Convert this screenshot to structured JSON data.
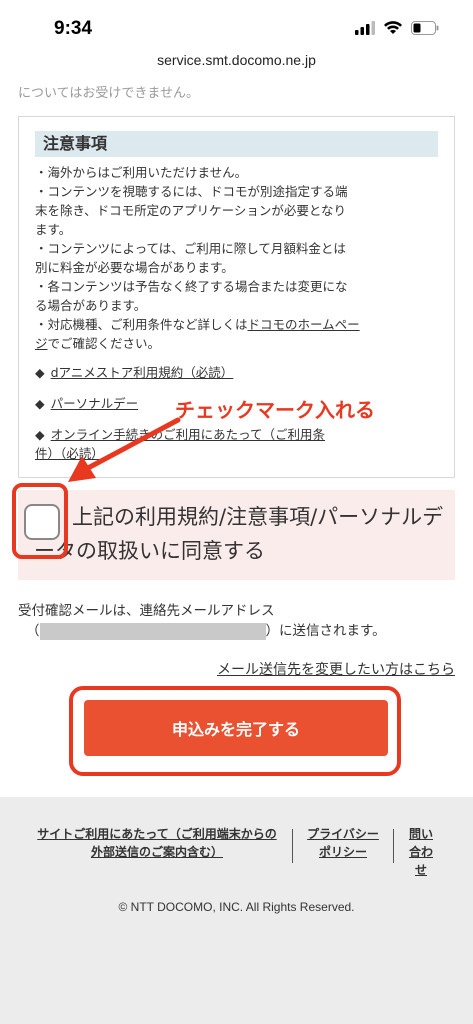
{
  "status_bar": {
    "time": "9:34"
  },
  "browser": {
    "url": "service.smt.docomo.ne.jp"
  },
  "ghost_text": "についてはお受けできません。",
  "notice": {
    "heading": "注意事項",
    "lines": [
      "・海外からはご利用いただけません。",
      "・コンテンツを視聴するには、ドコモが別途指定する端",
      "末を除き、ドコモ所定のアプリケーションが必要となり",
      "ます。",
      "・コンテンツによっては、ご利用に際して月額料金とは",
      "別に料金が必要な場合があります。",
      "・各コンテンツは予告なく終了する場合または変更にな",
      "る場合があります。"
    ],
    "last_line_prefix": "・対応機種、ご利用条件など詳しくは",
    "last_line_link": "ドコモのホームペー",
    "last_line_link2": "ジ",
    "last_line_suffix": "でご確認ください。",
    "doc_links": [
      {
        "diamond": "◆",
        "label": "dアニメストア利用規約（必読）"
      },
      {
        "diamond": "◆",
        "label": "パーソナルデー"
      },
      {
        "diamond": "◆",
        "label": "オンライン手続きのご利用にあたって（ご利用条"
      },
      {
        "diamond": "",
        "label": "件）（必読）"
      }
    ]
  },
  "consent": {
    "label": "上記の利用規約/注意事項/パーソナルデータの取扱いに同意する"
  },
  "annotation": {
    "text": "チェックマーク入れる",
    "color": "#e83820"
  },
  "receipt": {
    "line1": "受付確認メールは、連絡先メールアドレス",
    "open_paren": "（",
    "close_suffix": "）に送信されます。"
  },
  "change_email_link": "メール送信先を変更したい方はこちら",
  "submit": {
    "label": "申込みを完了する",
    "color": "#e95131"
  },
  "footer": {
    "link_site_l1": "サイトご利用にあたって（ご利用端末からの",
    "link_site_l2": "外部送信のご案内含む）",
    "link_privacy_l1": "プライバシー",
    "link_privacy_l2": "ポリシー",
    "link_contact_l1": "問い",
    "link_contact_l2": "合わ",
    "link_contact_l3": "せ",
    "copyright": "© NTT DOCOMO, INC. All Rights Reserved."
  }
}
